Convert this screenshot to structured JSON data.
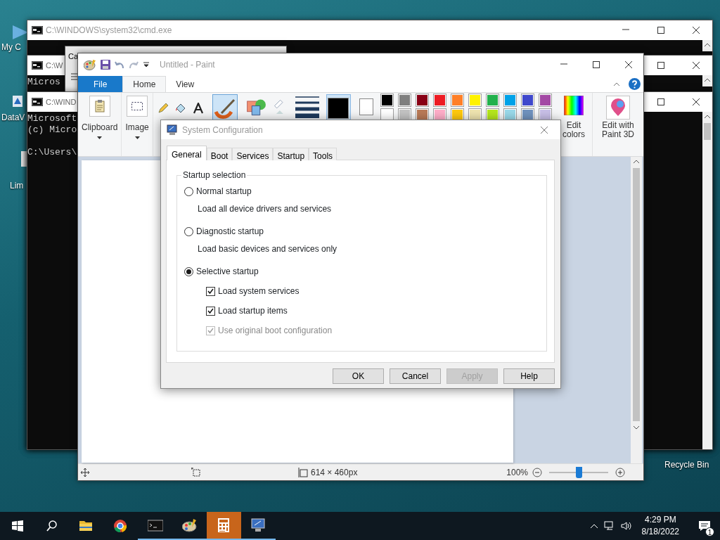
{
  "desktop_icons": [
    {
      "label": "My C"
    },
    {
      "label": "DataV"
    },
    {
      "label": "Lim"
    },
    {
      "label": "Recycle Bin"
    }
  ],
  "cmd_windows": [
    {
      "title": "C:\\WINDOWS\\system32\\cmd.exe"
    },
    {
      "title": "C:\\W",
      "lines": [
        "Micros"
      ]
    },
    {
      "title": "C:\\WIND",
      "lines": [
        "Microsoft",
        "(c) Micro"
      ],
      "prompt": "C:\\Users\\"
    }
  ],
  "calculator": {
    "title": "Ca"
  },
  "paint": {
    "title": "Untitled - Paint",
    "tabs": [
      {
        "label": "File",
        "kind": "file",
        "selected": false
      },
      {
        "label": "Home",
        "kind": "tab",
        "selected": true
      },
      {
        "label": "View",
        "kind": "tab",
        "selected": false
      }
    ],
    "groups": [
      {
        "label": "Clipboard",
        "kind": "clipboard"
      },
      {
        "label": "Image",
        "kind": "image"
      }
    ],
    "palette": [
      {
        "color": "#000000"
      },
      {
        "color": "#7f7f7f"
      },
      {
        "color": "#880015"
      },
      {
        "color": "#ed1c24"
      },
      {
        "color": "#ff7f27"
      },
      {
        "color": "#fff200"
      },
      {
        "color": "#22b14c"
      },
      {
        "color": "#00a2e8"
      },
      {
        "color": "#3f48cc"
      },
      {
        "color": "#a349a4"
      },
      {
        "color": "#ffffff"
      },
      {
        "color": "#c3c3c3"
      },
      {
        "color": "#b97a57"
      },
      {
        "color": "#ffaec9"
      },
      {
        "color": "#ffc90e"
      },
      {
        "color": "#efe4b0"
      },
      {
        "color": "#b5e61d"
      },
      {
        "color": "#99d9ea"
      },
      {
        "color": "#7092be"
      },
      {
        "color": "#c8bfe7"
      }
    ],
    "edit_colors": "Edit colors",
    "paint3d": "Edit with Paint 3D",
    "status": {
      "size": "614 × 460px",
      "zoom": "100%",
      "level": 0.5
    }
  },
  "dialog": {
    "title": "System Configuration",
    "tabs": [
      {
        "label": "General",
        "selected": true
      },
      {
        "label": "Boot",
        "selected": false
      },
      {
        "label": "Services",
        "selected": false
      },
      {
        "label": "Startup",
        "selected": false
      },
      {
        "label": "Tools",
        "selected": false
      }
    ],
    "group": "Startup selection",
    "options": [
      {
        "label": "Normal startup",
        "description": "Load all device drivers and services",
        "selected": false
      },
      {
        "label": "Diagnostic startup",
        "description": "Load basic devices and services only",
        "selected": false
      },
      {
        "label": "Selective startup",
        "selected": true
      }
    ],
    "checks": [
      {
        "label": "Load system services",
        "checked": true,
        "disabled": false
      },
      {
        "label": "Load startup items",
        "checked": true,
        "disabled": false
      },
      {
        "label": "Use original boot configuration",
        "checked": true,
        "disabled": true
      }
    ],
    "buttons": [
      {
        "label": "OK",
        "disabled": false
      },
      {
        "label": "Cancel",
        "disabled": false
      },
      {
        "label": "Apply",
        "disabled": true
      },
      {
        "label": "Help",
        "disabled": false
      }
    ]
  },
  "taskbar": {
    "apps": [
      {
        "kind": "folder",
        "active": false,
        "focused": false
      },
      {
        "kind": "browser",
        "active": false,
        "focused": false
      },
      {
        "kind": "terminal",
        "active": true,
        "focused": false
      },
      {
        "kind": "paint",
        "active": true,
        "focused": false
      },
      {
        "kind": "calculator",
        "active": true,
        "focused": true
      },
      {
        "kind": "msconfig",
        "active": true,
        "focused": false
      }
    ],
    "time": "4:29 PM",
    "date": "8/18/2022",
    "notifications": "1"
  }
}
